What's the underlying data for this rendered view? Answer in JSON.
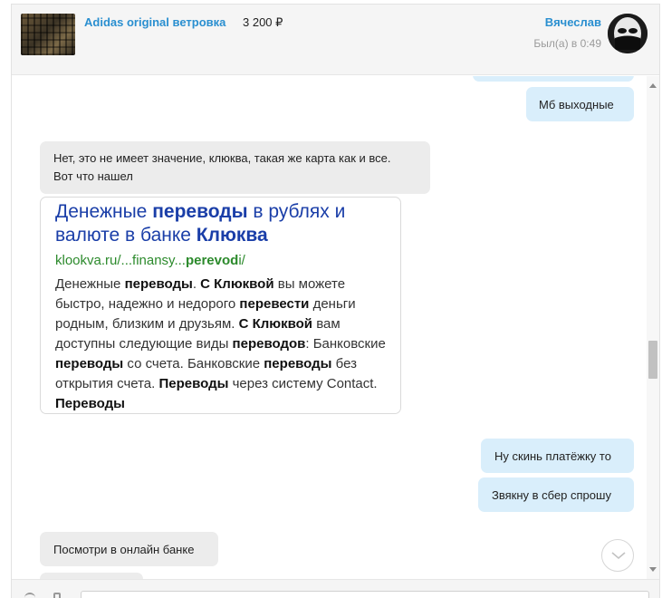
{
  "header": {
    "product_title": "Adidas original ветровка",
    "product_price": "3 200 ₽",
    "user_name": "Вячеслав",
    "user_status": "Был(а) в 0:49"
  },
  "messages": [
    {
      "direction": "out",
      "text": "Мб выходные"
    },
    {
      "direction": "in",
      "line1": "Нет, это не имеет значение, клюква, такая же карта как и все.",
      "line2": "Вот что нашел"
    },
    {
      "direction": "out",
      "text": "Ну скинь платёжку то"
    },
    {
      "direction": "out",
      "text": "Звякну в сбер спрошу"
    },
    {
      "direction": "in",
      "text": "Посмотри в онлайн банке"
    }
  ],
  "link_card": {
    "title_parts": [
      "Денежные ",
      "переводы",
      " в рублях и валюте в банке ",
      "Клюква"
    ],
    "url_parts": [
      "klookva.ru/...finansy...",
      "perevod",
      "i/"
    ],
    "snippet_parts": [
      "Денежные ",
      "переводы",
      ". ",
      "С Клюквой",
      " вы можете быстро, надежно и недорого ",
      "перевести",
      " деньги родным, близким и друзьям. ",
      "С Клюквой",
      " вам доступны следующие виды ",
      "переводов",
      ": Банковские ",
      "переводы",
      " со счета. Банковские ",
      "переводы",
      " без открытия счета. ",
      "Переводы",
      " через систему Contact. ",
      "Переводы"
    ]
  },
  "colors": {
    "accent": "#2a8fd0",
    "incoming_bubble": "#ececec",
    "outgoing_bubble": "#d9eefb",
    "card_title": "#1a3ea8",
    "card_url": "#2c8a2c"
  },
  "icons": {
    "scroll_down": "chevron-down-icon",
    "avatar": "avatar-mask"
  }
}
